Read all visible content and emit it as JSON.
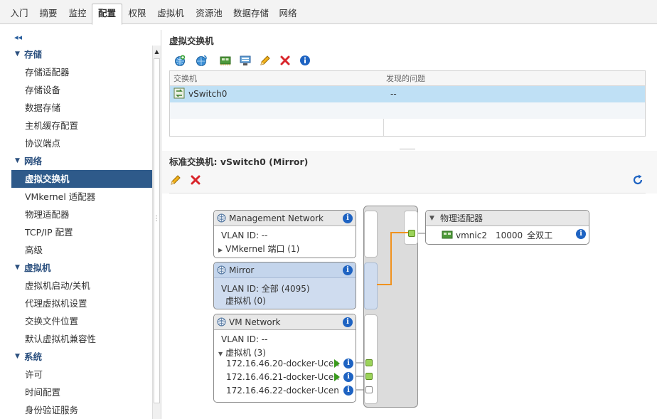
{
  "tabs": [
    "入门",
    "摘要",
    "监控",
    "配置",
    "权限",
    "虚拟机",
    "资源池",
    "数据存储",
    "网络"
  ],
  "active_tab": "配置",
  "sidebar": {
    "collapse_label": "◂◂",
    "groups": [
      {
        "label": "存储",
        "items": [
          "存储适配器",
          "存储设备",
          "数据存储",
          "主机缓存配置",
          "协议端点"
        ]
      },
      {
        "label": "网络",
        "items": [
          "虚拟交换机",
          "VMkernel 适配器",
          "物理适配器",
          "TCP/IP 配置",
          "高级"
        ]
      },
      {
        "label": "虚拟机",
        "items": [
          "虚拟机启动/关机",
          "代理虚拟机设置",
          "交换文件位置",
          "默认虚拟机兼容性"
        ]
      },
      {
        "label": "系统",
        "items": [
          "许可",
          "时间配置",
          "身份验证服务"
        ]
      }
    ],
    "selected_item": "虚拟交换机"
  },
  "vswitch_panel": {
    "title": "虚拟交换机",
    "columns": [
      "交换机",
      "发现的问题"
    ],
    "rows": [
      {
        "name": "vSwitch0",
        "issues": "--"
      }
    ]
  },
  "detail": {
    "title": "标准交换机: vSwitch0 (Mirror)",
    "port_groups": [
      {
        "name": "Management Network",
        "lines": [
          "VLAN ID: --",
          "VMkernel 端口 (1)"
        ]
      },
      {
        "name": "Mirror",
        "lines": [
          "VLAN ID: 全部 (4095)",
          "虚拟机 (0)"
        ]
      },
      {
        "name": "VM Network",
        "lines": [
          "VLAN ID: --",
          "虚拟机 (3)"
        ],
        "vms": [
          "172.16.46.20-docker-Ucen",
          "172.16.46.21-docker-Ucen",
          "172.16.46.22-docker-Ucen"
        ]
      }
    ],
    "physical": {
      "header": "物理适配器",
      "nic": "vmnic2",
      "speed": "10000",
      "duplex": "全双工"
    }
  },
  "colors": {
    "selected_nav": "#2e5a8a",
    "selected_row": "#bfe0f5",
    "info_blue": "#1e63c2",
    "uplink_orange": "#f0921e",
    "port_green": "#9bd35a",
    "delete_red": "#d9262c"
  }
}
